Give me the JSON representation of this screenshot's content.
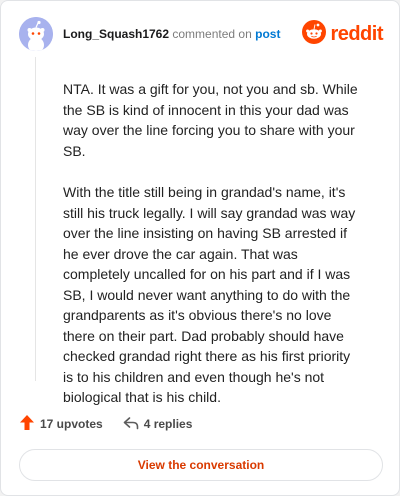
{
  "comment": {
    "username": "Long_Squash1762",
    "verb": "commented on",
    "target": "post",
    "paragraphs": [
      "NTA. It was a gift for you, not you and sb. While the SB is kind of innocent in this your dad was way over the line forcing you to share with your SB.",
      "With the title still being in grandad's name, it's still his truck legally. I will say grandad was way over the line insisting on having SB arrested if he ever drove the car again. That was completely uncalled for on his part and if I was SB, I would never want anything to do with the grandparents as it's obvious there's no love there on their part. Dad probably should have checked grandad right there as his first priority is to his children and even though he's not biological that is his child."
    ],
    "upvotes": "17 upvotes",
    "replies": "4 replies",
    "cta_label": "View the conversation"
  },
  "brand": {
    "name": "reddit",
    "color": "#ff4500"
  },
  "icons": {
    "avatar": "snoo-avatar-icon",
    "logo": "reddit-snoo-icon",
    "upvote": "upvote-arrow-icon",
    "reply": "reply-arrow-icon"
  },
  "colors": {
    "accent": "#ff4500",
    "link": "#0079d3",
    "cta_text": "#d93a00",
    "avatar_bg": "#a8b2ee"
  }
}
